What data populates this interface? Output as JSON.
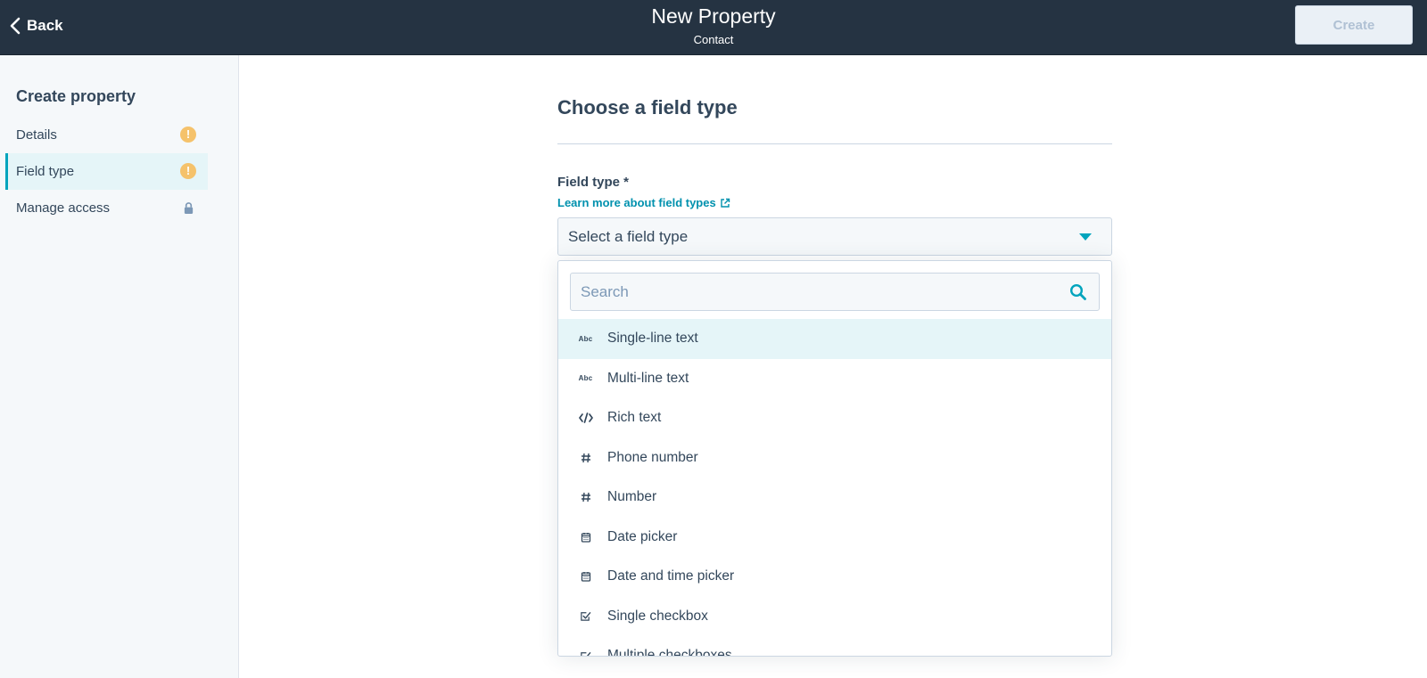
{
  "header": {
    "back_label": "Back",
    "title": "New Property",
    "subtitle": "Contact",
    "create_label": "Create"
  },
  "sidebar": {
    "heading": "Create property",
    "items": [
      {
        "label": "Details",
        "status": "warning-icon",
        "active": false
      },
      {
        "label": "Field type",
        "status": "warning-icon",
        "active": true
      },
      {
        "label": "Manage access",
        "status": "lock-icon",
        "active": false
      }
    ]
  },
  "main": {
    "section_title": "Choose a field type",
    "field_label": "Field type *",
    "learn_more": "Learn more about field types",
    "select_placeholder": "Select a field type",
    "search_placeholder": "Search",
    "options": [
      {
        "label": "Single-line text",
        "icon": "abc-icon"
      },
      {
        "label": "Multi-line text",
        "icon": "abc-icon"
      },
      {
        "label": "Rich text",
        "icon": "code-icon"
      },
      {
        "label": "Phone number",
        "icon": "hash-icon"
      },
      {
        "label": "Number",
        "icon": "hash-icon"
      },
      {
        "label": "Date picker",
        "icon": "calendar-icon"
      },
      {
        "label": "Date and time picker",
        "icon": "calendar-icon"
      },
      {
        "label": "Single checkbox",
        "icon": "checkbox-icon"
      },
      {
        "label": "Multiple checkboxes",
        "icon": "checkbox-icon"
      }
    ]
  },
  "colors": {
    "header_bg": "#253342",
    "accent": "#00a4bd",
    "link": "#0091ae",
    "warning": "#f5c26b",
    "highlight": "#e5f5f8"
  }
}
